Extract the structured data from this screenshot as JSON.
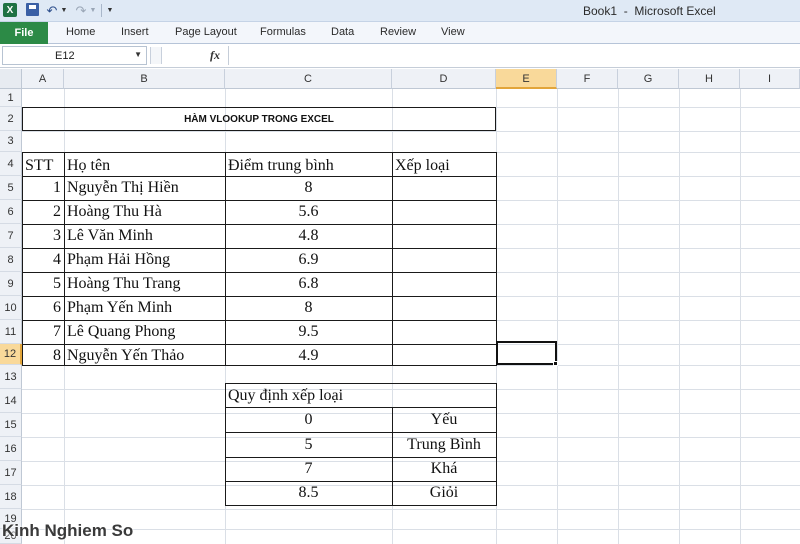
{
  "window": {
    "title": "Book1  -  Microsoft Excel",
    "app_icon": "X"
  },
  "ribbon": {
    "file": "File",
    "tabs": [
      "Home",
      "Insert",
      "Page Layout",
      "Formulas",
      "Data",
      "Review",
      "View"
    ]
  },
  "formula_bar": {
    "name_box": "E12",
    "fx": "fx",
    "value": ""
  },
  "columns": [
    "A",
    "B",
    "C",
    "D",
    "E",
    "F",
    "G",
    "H",
    "I"
  ],
  "selected_column": "E",
  "rows": [
    "1",
    "2",
    "3",
    "4",
    "5",
    "6",
    "7",
    "8",
    "9",
    "10",
    "11",
    "12",
    "13",
    "14",
    "15",
    "16",
    "17",
    "18",
    "19",
    "20"
  ],
  "selected_row": "12",
  "sheet": {
    "title": "HÀM VLOOKUP TRONG EXCEL",
    "headers": {
      "stt": "STT",
      "name": "Họ tên",
      "score": "Điểm trung bình",
      "rank": "Xếp loại"
    },
    "students": [
      {
        "stt": "1",
        "name": "Nguyễn Thị Hiền",
        "score": "8"
      },
      {
        "stt": "2",
        "name": "Hoàng Thu Hà",
        "score": "5.6"
      },
      {
        "stt": "3",
        "name": "Lê Văn Minh",
        "score": "4.8"
      },
      {
        "stt": "4",
        "name": "Phạm Hải Hồng",
        "score": "6.9"
      },
      {
        "stt": "5",
        "name": "Hoàng Thu Trang",
        "score": "6.8"
      },
      {
        "stt": "6",
        "name": "Phạm Yến Minh",
        "score": "8"
      },
      {
        "stt": "7",
        "name": "Lê Quang Phong",
        "score": "9.5"
      },
      {
        "stt": "8",
        "name": "Nguyễn Yến Thảo",
        "score": "4.9"
      }
    ],
    "rule_title": "Quy định xếp loại",
    "rules": [
      {
        "min": "0",
        "label": "Yếu"
      },
      {
        "min": "5",
        "label": "Trung Bình"
      },
      {
        "min": "7",
        "label": "Khá"
      },
      {
        "min": "8.5",
        "label": "Giỏi"
      }
    ]
  },
  "watermark": "Kinh Nghiem So",
  "colors": {
    "file_tab": "#2c8a46",
    "selection_header": "#f9d99a",
    "title_bar": "#dfe9f5"
  }
}
